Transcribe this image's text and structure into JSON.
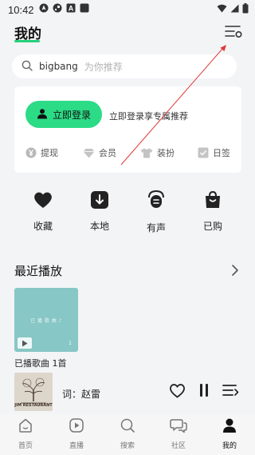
{
  "status_bar": {
    "time": "10:42",
    "icons": [
      "location-icon",
      "steam-icon",
      "text-a-icon",
      "app-icon",
      "wifi-icon",
      "signal-icon",
      "battery-icon"
    ]
  },
  "header": {
    "title": "我的",
    "settings_icon": "settings-list-icon",
    "accent": "#25d07a"
  },
  "search": {
    "keyword": "bigbang",
    "placeholder": "为你推荐",
    "icon": "search-icon"
  },
  "login_card": {
    "button_label": "立即登录",
    "hint": "立即登录享专属推荐",
    "button_color": "#2cdb86",
    "quick_links": [
      {
        "label": "提现",
        "icon": "yuan-icon"
      },
      {
        "label": "会员",
        "icon": "diamond-icon"
      },
      {
        "label": "装扮",
        "icon": "shirt-icon"
      },
      {
        "label": "日签",
        "icon": "checkbox-icon"
      }
    ]
  },
  "functions": [
    {
      "label": "收藏",
      "icon": "heart-icon"
    },
    {
      "label": "本地",
      "icon": "download-icon"
    },
    {
      "label": "有声",
      "icon": "audiobook-icon"
    },
    {
      "label": "已购",
      "icon": "shopping-bag-icon"
    }
  ],
  "recent": {
    "title": "最近播放",
    "thumb_title": "已 播 歌 曲 ♪",
    "thumb_count": "1",
    "caption": "已播歌曲 1首",
    "thumb_color": "#87c7c5"
  },
  "player": {
    "now_playing": "词：赵雷",
    "album_text": "JIM RESTAURANT"
  },
  "nav": [
    {
      "label": "首页",
      "icon": "home-icon",
      "active": false
    },
    {
      "label": "直播",
      "icon": "live-play-icon",
      "active": false
    },
    {
      "label": "搜索",
      "icon": "search-icon",
      "active": false
    },
    {
      "label": "社区",
      "icon": "community-icon",
      "active": false
    },
    {
      "label": "我的",
      "icon": "profile-icon",
      "active": true
    }
  ]
}
